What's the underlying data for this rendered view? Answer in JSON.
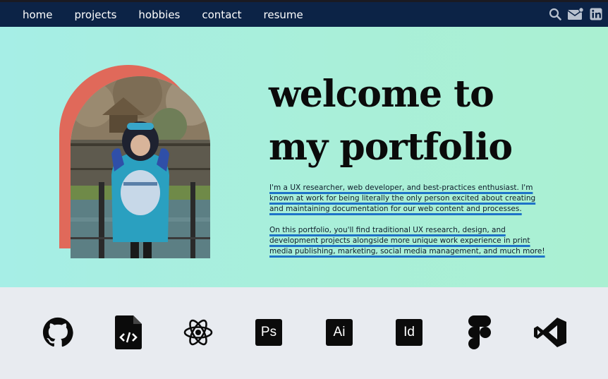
{
  "nav": {
    "links": [
      "home",
      "projects",
      "hobbies",
      "contact",
      "resume"
    ],
    "icons": [
      "search-icon",
      "mail-icon",
      "linkedin-icon"
    ]
  },
  "hero": {
    "headline_line1": "welcome to",
    "headline_line2": "my portfolio",
    "paragraph1": "I'm a UX researcher, web developer, and best-practices enthusiast. I'm known at work for being literally the only person excited about creating and maintaining documentation for our web content and processes.",
    "paragraph2": "On this portfolio, you'll find traditional UX research, design, and development projects alongside more unique work experience in print media publishing, marketing, social media management, and much more!",
    "photo_alt": "profile-photo"
  },
  "skills": {
    "icons": [
      "github-icon",
      "html-file-icon",
      "react-icon",
      "photoshop-icon",
      "illustrator-icon",
      "indesign-icon",
      "figma-icon",
      "visual-studio-icon"
    ],
    "ps_label": "Ps",
    "ai_label": "Ai",
    "id_label": "Id"
  },
  "colors": {
    "nav_bg": "#0c2346",
    "hero_bg": "#a6eee6",
    "arch_accent": "#e0695a",
    "link_underline": "#1e73c8",
    "skills_bg": "#e8ebf0"
  }
}
